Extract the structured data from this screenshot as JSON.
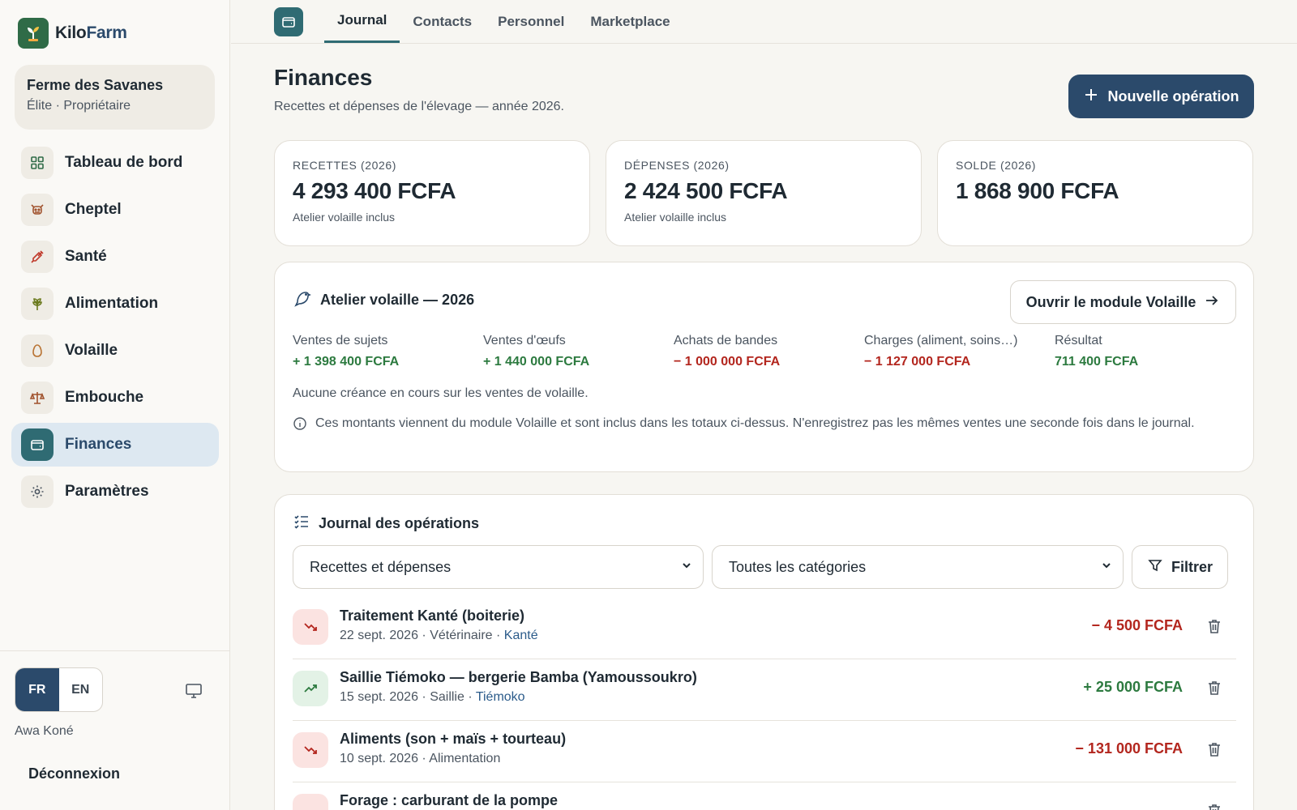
{
  "brand": {
    "name_a": "Kilo",
    "name_b": "Farm"
  },
  "farm": {
    "name": "Ferme des Savanes",
    "role": "Élite · Propriétaire"
  },
  "nav": [
    {
      "label": "Tableau de bord",
      "icon": "grid-icon"
    },
    {
      "label": "Cheptel",
      "icon": "cow-icon"
    },
    {
      "label": "Santé",
      "icon": "syringe-icon"
    },
    {
      "label": "Alimentation",
      "icon": "wheat-icon"
    },
    {
      "label": "Volaille",
      "icon": "egg-icon"
    },
    {
      "label": "Embouche",
      "icon": "scale-icon"
    },
    {
      "label": "Finances",
      "icon": "wallet-icon",
      "active": true
    },
    {
      "label": "Paramètres",
      "icon": "gear-icon"
    }
  ],
  "footer": {
    "lang_fr": "FR",
    "lang_en": "EN",
    "user": "Awa Koné",
    "logout": "Déconnexion"
  },
  "tabs": [
    "Journal",
    "Contacts",
    "Personnel",
    "Marketplace"
  ],
  "page": {
    "title": "Finances",
    "subtitle": "Recettes et dépenses de l'élevage — année 2026.",
    "new_op": "Nouvelle opération"
  },
  "stats": [
    {
      "label": "RECETTES (2026)",
      "value": "4 293 400 FCFA",
      "note": "Atelier volaille inclus"
    },
    {
      "label": "DÉPENSES (2026)",
      "value": "2 424 500 FCFA",
      "note": "Atelier volaille inclus"
    },
    {
      "label": "SOLDE (2026)",
      "value": "1 868 900 FCFA",
      "note": ""
    }
  ],
  "poultry": {
    "title": "Atelier volaille — 2026",
    "open_btn": "Ouvrir le module Volaille",
    "metrics": [
      {
        "label": "Ventes de sujets",
        "value": "+ 1 398 400 FCFA",
        "tone": "pos"
      },
      {
        "label": "Ventes d'œufs",
        "value": "+ 1 440 000 FCFA",
        "tone": "pos"
      },
      {
        "label": "Achats de bandes",
        "value": "− 1 000 000 FCFA",
        "tone": "neg"
      },
      {
        "label": "Charges (aliment, soins…)",
        "value": "− 1 127 000 FCFA",
        "tone": "neg"
      },
      {
        "label": "Résultat",
        "value": "711 400 FCFA",
        "tone": "pos"
      }
    ],
    "no_claims": "Aucune créance en cours sur les ventes de volaille.",
    "info": "Ces montants viennent du module Volaille et sont inclus dans les totaux ci-dessus. N'enregistrez pas les mêmes ventes une seconde fois dans le journal."
  },
  "journal": {
    "title": "Journal des opérations",
    "filter_type": "Recettes et dépenses",
    "filter_category": "Toutes les catégories",
    "filter_btn": "Filtrer",
    "rows": [
      {
        "title": "Traitement Kanté (boiterie)",
        "meta": "22 sept. 2026 · Vétérinaire · ",
        "link": "Kanté",
        "amount": "− 4 500 FCFA",
        "direction": "out"
      },
      {
        "title": "Saillie Tiémoko — bergerie Bamba (Yamoussoukro)",
        "meta": "15 sept. 2026 · Saillie · ",
        "link": "Tiémoko",
        "amount": "+ 25 000 FCFA",
        "direction": "in"
      },
      {
        "title": "Aliments (son + maïs + tourteau)",
        "meta": "10 sept. 2026 · Alimentation",
        "link": "",
        "amount": "− 131 000 FCFA",
        "direction": "out"
      },
      {
        "title": "Forage : carburant de la pompe",
        "meta": "",
        "link": "",
        "amount": "",
        "direction": "out"
      }
    ]
  },
  "colors": {
    "primary": "#2b4a6b",
    "teal": "#2f6b73",
    "positive": "#2c7a3f",
    "negative": "#b3261e",
    "brand_green": "#2f6b47"
  }
}
